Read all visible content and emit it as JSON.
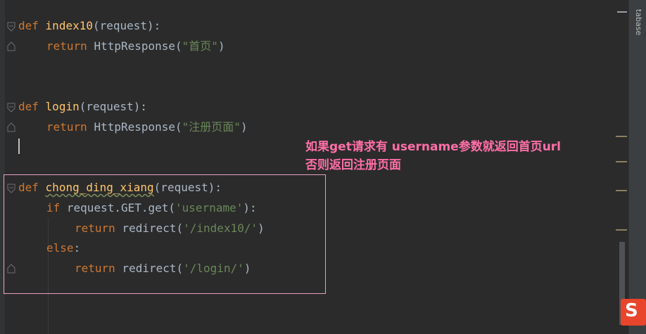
{
  "editor": {
    "lines": [
      {
        "def": "def",
        "name": "index10",
        "params": "(request):"
      },
      {
        "ret": "return",
        "call": "HttpResponse(",
        "str": "\"首页\"",
        "close": ")"
      },
      {
        "def": "def",
        "name": "login",
        "params": "(request):"
      },
      {
        "ret": "return",
        "call": "HttpResponse(",
        "str": "\"注册页面\"",
        "close": ")"
      },
      {
        "def": "def",
        "name": "chong_ding_xiang",
        "params": "(request):"
      },
      {
        "if": "if",
        "cond_pre": "request.GET.get(",
        "str": "'username'",
        "cond_post": "):"
      },
      {
        "ret": "return",
        "call": "redirect(",
        "str": "'/index10/'",
        "close": ")"
      },
      {
        "else": "else",
        "colon": ":"
      },
      {
        "ret": "return",
        "call": "redirect(",
        "str": "'/login/'",
        "close": ")"
      }
    ]
  },
  "annotation": {
    "line1": "如果get请求有 username参数就返回首页url",
    "line2": "否则返回注册页面"
  },
  "side_panel": {
    "tab_label": "tabase"
  },
  "ime": {
    "label": "S"
  },
  "colors": {
    "background": "#2b2b2b",
    "keyword": "#cc7832",
    "function_name": "#ffc66d",
    "string": "#6a8759",
    "text": "#a9b7c6",
    "annotation": "#ff6fa8",
    "highlight_box": "#e8a0c0"
  }
}
